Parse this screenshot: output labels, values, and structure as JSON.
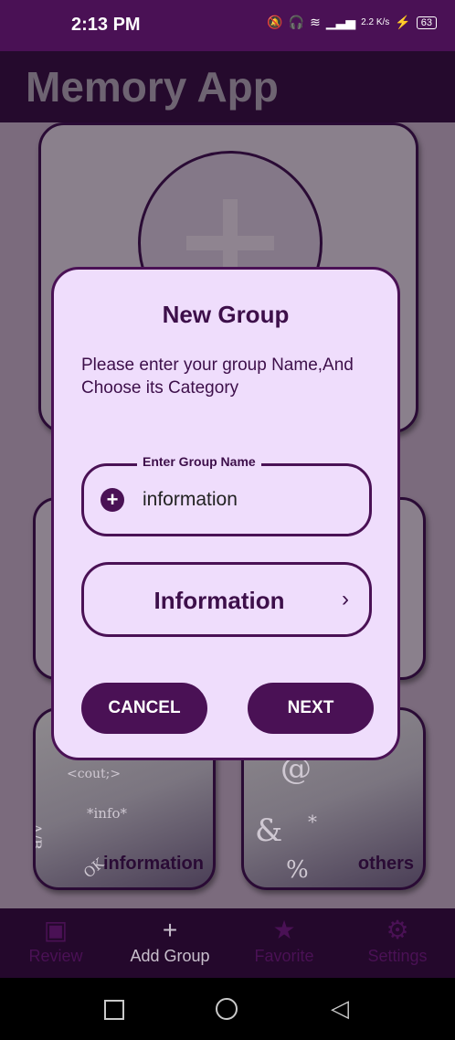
{
  "status_bar": {
    "time": "2:13 PM",
    "network_speed": "2.2 K/s",
    "battery": "63"
  },
  "app_bar": {
    "title": "Memory App"
  },
  "categories": [
    {
      "label": "information",
      "decorations": [
        "<cout;>",
        "*info*",
        "A/B",
        "OK"
      ]
    },
    {
      "label": "others",
      "decorations": [
        "@",
        "&",
        "*",
        "%"
      ]
    }
  ],
  "bottom_nav": {
    "items": [
      {
        "label": "Review",
        "icon": "chat-plus-icon"
      },
      {
        "label": "Add Group",
        "icon": "plus-icon"
      },
      {
        "label": "Favorite",
        "icon": "star-icon"
      },
      {
        "label": "Settings",
        "icon": "gear-icon"
      }
    ]
  },
  "dialog": {
    "title": "New Group",
    "message": "Please enter your group Name,And Choose its Category",
    "field_label": "Enter Group Name",
    "field_value": "information",
    "category_value": "Information",
    "cancel_label": "CANCEL",
    "next_label": "NEXT"
  },
  "colors": {
    "primary": "#4a1155",
    "dialog_bg": "#efddfc",
    "app_bar": "#250a2d"
  }
}
